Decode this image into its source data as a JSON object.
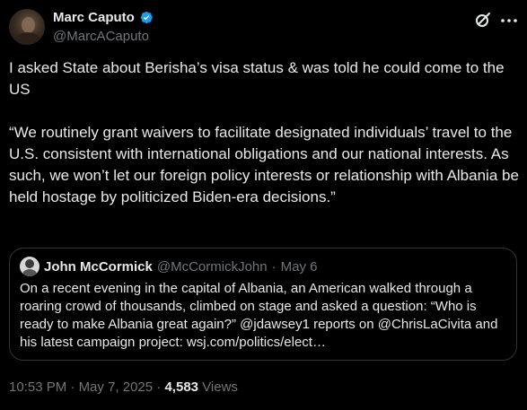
{
  "author": {
    "display_name": "Marc Caputo",
    "handle": "@MarcACaputo",
    "verified_color": "#1d9bf0"
  },
  "header_icons": [
    "grok-icon",
    "more-icon"
  ],
  "tweet": {
    "paragraphs": [
      "I asked State about Berisha’s visa status & was told he could come to the US",
      "“We routinely grant waivers to facilitate designated individuals’ travel to the U.S. consistent with international obligations and our national interests. As such, we won’t let our foreign policy interests or relationship with Albania be held hostage by politicized Biden-era decisions.”"
    ]
  },
  "quoted_tweet": {
    "display_name": "John McCormick",
    "handle": "@McCormickJohn",
    "separator": "·",
    "date": "May 6",
    "text": "On a recent evening in the capital of Albania, an American walked through a roaring crowd of thousands, climbed on stage and asked a question: “Who is ready to make Albania great again?” @jdawsey1 reports on @ChrisLaCivita and his latest campaign project: wsj.com/politics/elect…"
  },
  "meta": {
    "time": "10:53 PM",
    "separator": "·",
    "date": "May 7, 2025",
    "views_count": "4,583",
    "views_label": "Views"
  },
  "colors": {
    "background": "#000000",
    "text": "#e7e9ea",
    "secondary": "#71767b",
    "border": "#2f3336",
    "accent": "#1d9bf0"
  }
}
